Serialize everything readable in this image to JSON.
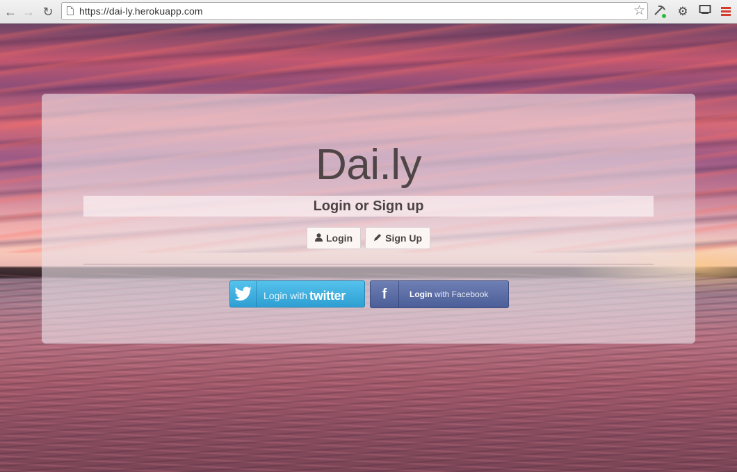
{
  "browser": {
    "url": "https://dai-ly.herokuapp.com",
    "back_icon": "back-arrow-icon",
    "forward_icon": "forward-arrow-icon",
    "reload_icon": "reload-icon",
    "page_icon": "page-icon",
    "bookmark_icon": "star-icon",
    "extensions": [
      "pickaxe-icon",
      "gear-icon",
      "cast-icon"
    ],
    "menu_icon": "hamburger-menu-icon",
    "menu_color": "#d63a2a"
  },
  "panel": {
    "brand": "Dai.ly",
    "subtitle": "Login or Sign up",
    "login_label": "Login",
    "login_icon": "user-icon",
    "signup_label": "Sign Up",
    "signup_icon": "pencil-icon"
  },
  "social": {
    "twitter_prefix": "Login with",
    "twitter_word": "twitter",
    "twitter_color": "#3aaee0",
    "facebook_strong": "Login",
    "facebook_rest": "with Facebook",
    "facebook_color": "#5a6ca5"
  }
}
